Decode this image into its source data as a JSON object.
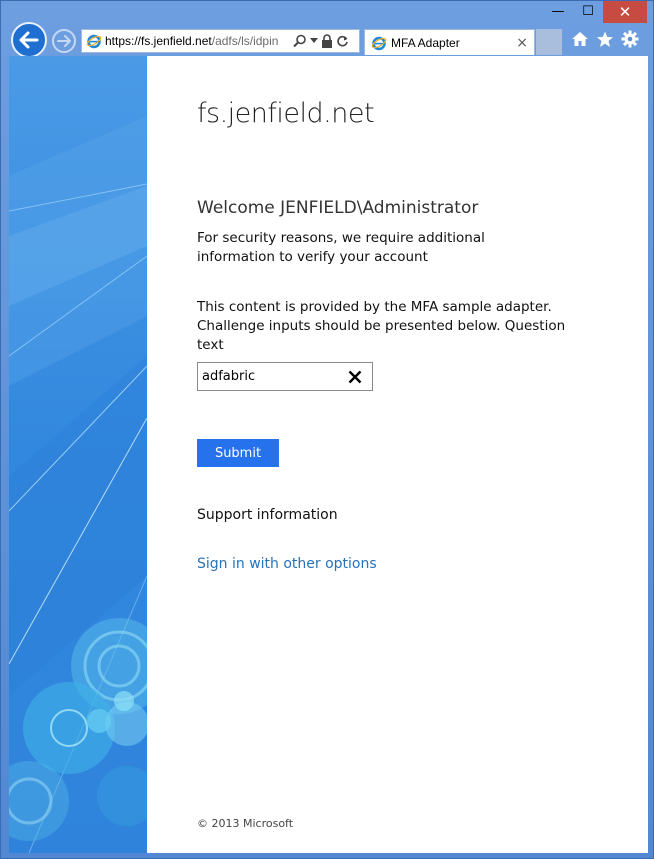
{
  "browser": {
    "address": {
      "url_host": "https://fs.jenfield.net",
      "url_path": "/adfs/ls/idpin"
    },
    "tab": {
      "title": "MFA Adapter",
      "close": "×"
    },
    "caption": {
      "minimize": "—",
      "maximize": "☐",
      "close": "✕"
    }
  },
  "page": {
    "host": "fs.jenfield.net",
    "welcome": "Welcome JENFIELD\\Administrator",
    "security_text": "For security reasons, we require additional information to verify your account",
    "adapter_text": "This content is provided by the MFA sample adapter. Challenge inputs should be presented below. Question text",
    "answer_value": "adfabric",
    "submit_label": "Submit",
    "support_label": "Support information",
    "other_options_label": "Sign in with other options",
    "footer": "© 2013 Microsoft"
  },
  "colors": {
    "accent": "#2672ec",
    "link": "#2672b8",
    "illustration": "#3f8fe0"
  }
}
